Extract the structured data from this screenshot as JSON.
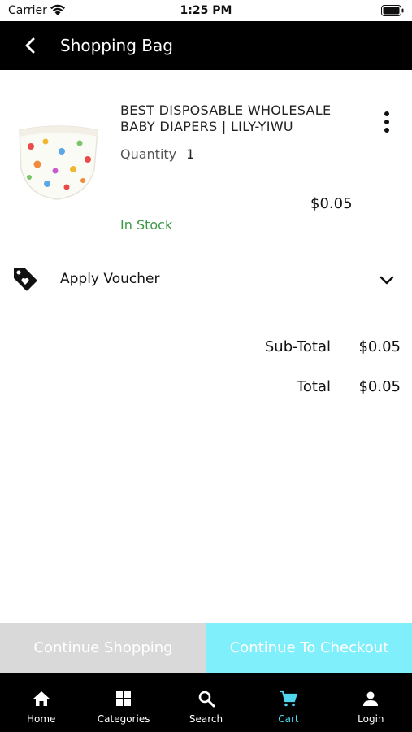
{
  "status_bar": {
    "carrier": "Carrier",
    "time": "1:25 PM"
  },
  "header": {
    "title": "Shopping Bag",
    "back_icon": "chevron-left-icon"
  },
  "cart_item": {
    "title": "BEST DISPOSABLE WHOLESALE BABY DIAPERS | LILY-YIWU",
    "quantity_label": "Quantity",
    "quantity_value": "1",
    "price": "$0.05",
    "stock_status": "In Stock",
    "more_icon": "more-vertical-icon"
  },
  "voucher": {
    "label": "Apply Voucher",
    "icon": "tag-icon",
    "chevron": "chevron-down-icon"
  },
  "totals": {
    "subtotal_label": "Sub-Total",
    "subtotal_value": "$0.05",
    "total_label": "Total",
    "total_value": "$0.05"
  },
  "actions": {
    "continue_shopping": "Continue Shopping",
    "checkout": "Continue To Checkout"
  },
  "bottom_nav": {
    "items": [
      {
        "label": "Home",
        "icon": "home-icon"
      },
      {
        "label": "Categories",
        "icon": "grid-icon"
      },
      {
        "label": "Search",
        "icon": "search-icon"
      },
      {
        "label": "Cart",
        "icon": "cart-icon"
      },
      {
        "label": "Login",
        "icon": "user-icon"
      }
    ],
    "active": "Cart"
  },
  "colors": {
    "header_bg": "#000000",
    "in_stock": "#3c9a47",
    "checkout_bg": "#7ff0fb",
    "continue_bg": "#d9d9d9",
    "active_nav": "#4fd6ec"
  }
}
